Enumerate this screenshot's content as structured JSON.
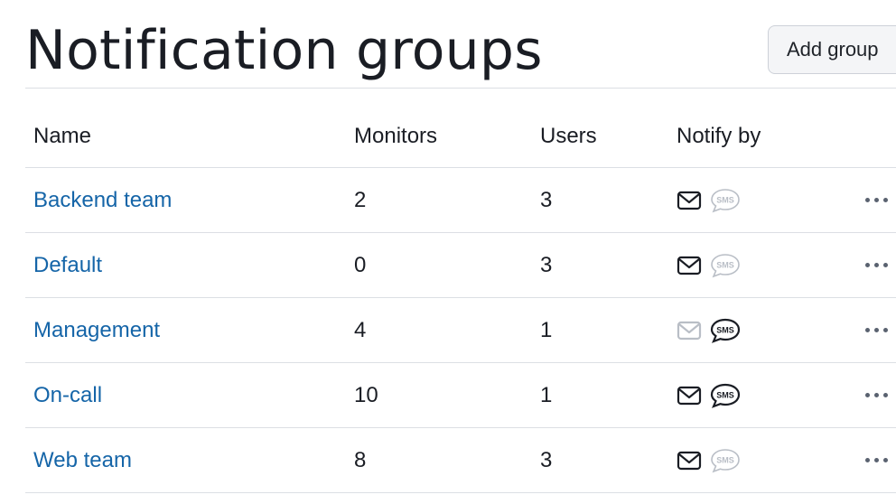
{
  "page": {
    "title": "Notification groups",
    "add_button_label": "Add group"
  },
  "table": {
    "headers": {
      "name": "Name",
      "monitors": "Monitors",
      "users": "Users",
      "notify_by": "Notify by"
    },
    "rows": [
      {
        "name": "Backend team",
        "monitors": "2",
        "users": "3",
        "email_enabled": true,
        "sms_enabled": false
      },
      {
        "name": "Default",
        "monitors": "0",
        "users": "3",
        "email_enabled": true,
        "sms_enabled": false
      },
      {
        "name": "Management",
        "monitors": "4",
        "users": "1",
        "email_enabled": false,
        "sms_enabled": true
      },
      {
        "name": "On-call",
        "monitors": "10",
        "users": "1",
        "email_enabled": true,
        "sms_enabled": true
      },
      {
        "name": "Web team",
        "monitors": "8",
        "users": "3",
        "email_enabled": true,
        "sms_enabled": false
      }
    ]
  },
  "icons": {
    "email": "envelope-icon",
    "sms": "sms-bubble-icon",
    "more": "more-horizontal-icon",
    "sms_glyph_text": "SMS"
  },
  "colors": {
    "link": "#1565a8",
    "icon_active": "#1a1d24",
    "icon_inactive": "#b9bec6"
  }
}
